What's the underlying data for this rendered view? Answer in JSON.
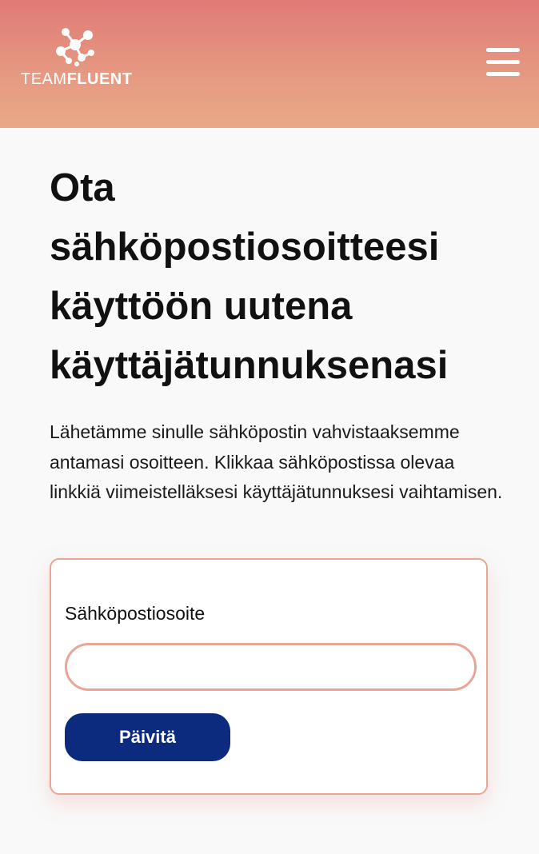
{
  "header": {
    "logo": {
      "text_light": "TEAM",
      "text_bold": "FLUENT",
      "icon": "molecule-logo-icon"
    },
    "menu_icon": "hamburger-menu-icon"
  },
  "main": {
    "title": "Ota sähköpostiosoitteesi käyttöön uutena käyttäjätunnuksenasi",
    "intro": "Lähetämme sinulle sähköpostin vahvistaaksemme antamasi osoitteen. Klikkaa sähköpostissa olevaa linkkiä viimeistelläksesi käyttäjätunnuksesi vaihtamisen."
  },
  "form": {
    "email_label": "Sähköpostiosoite",
    "email_value": "",
    "submit_label": "Päivitä"
  },
  "colors": {
    "header_gradient_top": "#e07a76",
    "header_gradient_bottom": "#e9a886",
    "accent_border": "#e9a596",
    "button_background": "#0d2b7e"
  }
}
